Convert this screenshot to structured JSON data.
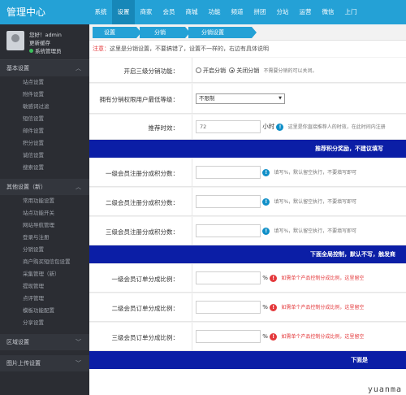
{
  "app": {
    "title": "管理中心"
  },
  "topnav": [
    {
      "label": "系统"
    },
    {
      "label": "设置"
    },
    {
      "label": "商家"
    },
    {
      "label": "会员"
    },
    {
      "label": "商城"
    },
    {
      "label": "功能"
    },
    {
      "label": "频道"
    },
    {
      "label": "拼团"
    },
    {
      "label": "分站"
    },
    {
      "label": "运营"
    },
    {
      "label": "微信"
    },
    {
      "label": "上门"
    }
  ],
  "user": {
    "greeting": "您好！admin",
    "clear_cache": "更新缓存",
    "role": "系统管理员"
  },
  "sidebar": {
    "section1": {
      "label": "基本设置"
    },
    "section1_items": [
      {
        "label": "站点设置"
      },
      {
        "label": "附件设置"
      },
      {
        "label": "敏感词过滤"
      },
      {
        "label": "短信设置"
      },
      {
        "label": "邮件设置"
      },
      {
        "label": "积分设置"
      },
      {
        "label": "诚信设置"
      },
      {
        "label": "搜索设置"
      }
    ],
    "section2": {
      "label": "其他设置（新）"
    },
    "section2_items": [
      {
        "label": "常用功能设置"
      },
      {
        "label": "站点功能开关"
      },
      {
        "label": "网站导航管理"
      },
      {
        "label": "登录与注册"
      },
      {
        "label": "分销设置"
      },
      {
        "label": "商户购买短信包设置"
      },
      {
        "label": "采集管理（新）"
      },
      {
        "label": "提现管理"
      },
      {
        "label": "点评管理"
      },
      {
        "label": "模板功能配置"
      },
      {
        "label": "分享设置"
      }
    ],
    "section3": {
      "label": "区域设置"
    },
    "section4": {
      "label": "图片上传设置"
    }
  },
  "breadcrumb": [
    {
      "label": "设置"
    },
    {
      "label": "分销"
    },
    {
      "label": "分销设置"
    }
  ],
  "notice": {
    "prefix": "注意：",
    "text": "这里是分销设置，不要搞错了，设置不一样的，右边有具体说明"
  },
  "form": {
    "enable": {
      "label": "开启三级分销功能：",
      "option_on": "开启分销",
      "option_off": "关闭分销",
      "hint": "不需要分销的可以关闭。"
    },
    "level": {
      "label": "拥有分销权限用户最低等级：",
      "value": "不限制"
    },
    "time": {
      "label": "推荐时效：",
      "value": "72",
      "unit": "小时",
      "hint": "这里是你直接推荐人的时效，在此时间内注册"
    },
    "band1": {
      "text": "推荐积分奖励，不建议填写"
    },
    "points": [
      {
        "label": "一级会员注册分成积分数：",
        "hint": "填写%，默认留空执行，不要填写即可"
      },
      {
        "label": "二级会员注册分成积分数：",
        "hint": "填写%，默认留空执行，不要填写即可"
      },
      {
        "label": "三级会员注册分成积分数：",
        "hint": "填写%，默认留空执行，不要填写即可"
      }
    ],
    "band2": {
      "text": "下面全局控制，默认不写，触发商"
    },
    "orders": [
      {
        "label": "一级会员订单分成比例：",
        "unit": "%",
        "hint": "如需单个产品控制分成比例，这里留空"
      },
      {
        "label": "二级会员订单分成比例：",
        "unit": "%",
        "hint": "如需单个产品控制分成比例，这里留空"
      },
      {
        "label": "三级会员订单分成比例：",
        "unit": "%",
        "hint": "如需单个产品控制分成比例，这里留空"
      }
    ],
    "band3": {
      "text": "下面是"
    }
  },
  "watermark": {
    "text": "yuanma"
  },
  "colors": {
    "topbar": "#24a1d6",
    "sidebar": "#2b2d33",
    "band": "#0b1ea6",
    "warn": "#e4393c",
    "info": "#0f8fc8"
  }
}
